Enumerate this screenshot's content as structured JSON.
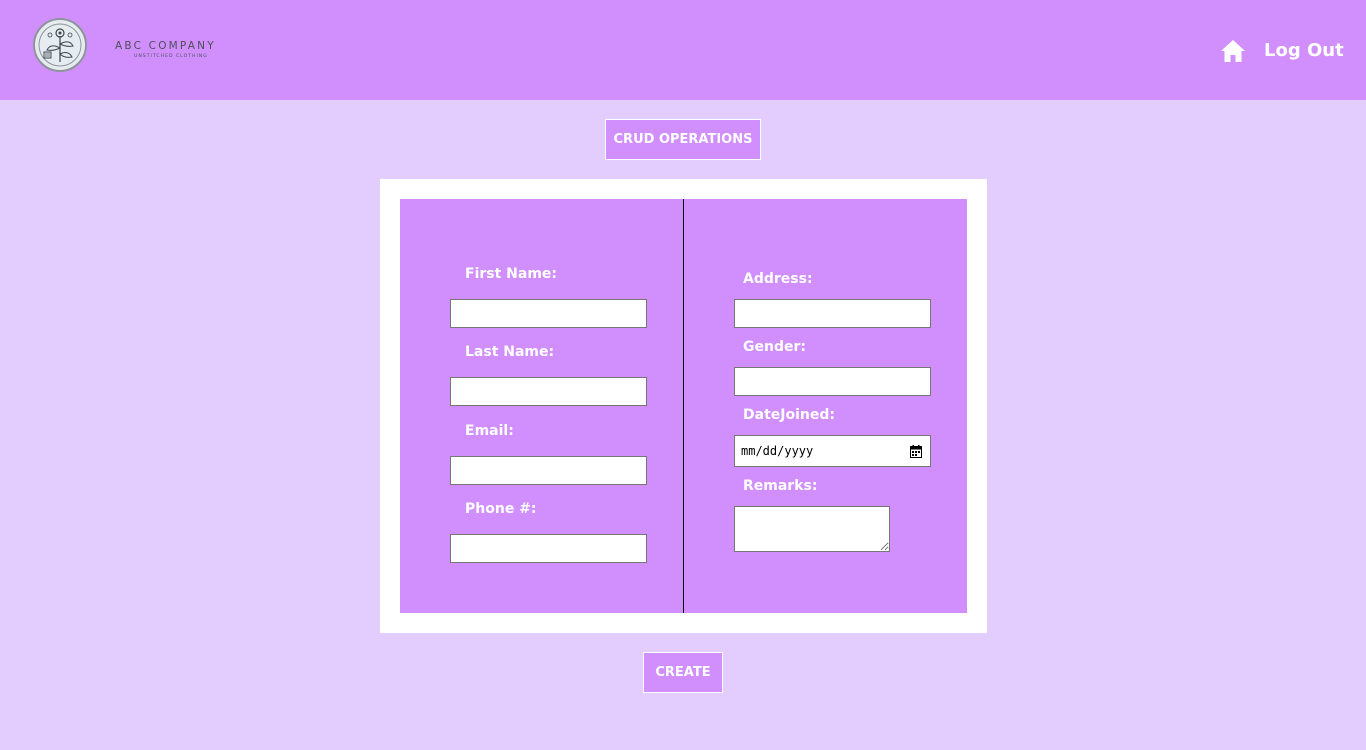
{
  "header": {
    "company_name": "ABC COMPANY",
    "company_tagline": "UNSTITCHED CLOTHING",
    "home_icon": "home-icon",
    "logout_label": "Log Out"
  },
  "crud_button_label": "CRUD OPERATIONS",
  "form": {
    "left": {
      "first_name_label": "First Name:",
      "first_name_value": "",
      "last_name_label": "Last Name:",
      "last_name_value": "",
      "email_label": "Email:",
      "email_value": "",
      "phone_label": "Phone #:",
      "phone_value": ""
    },
    "right": {
      "address_label": "Address:",
      "address_value": "",
      "gender_label": "Gender:",
      "gender_value": "",
      "date_joined_label": "DateJoined:",
      "date_joined_placeholder": "mm/dd/yyyy",
      "remarks_label": "Remarks:",
      "remarks_value": ""
    }
  },
  "create_button_label": "CREATE",
  "colors": {
    "header_bg": "#d18ffe",
    "page_bg": "#e3cdfe",
    "panel_bg": "#d18ffe",
    "text_white": "#ffffff"
  }
}
